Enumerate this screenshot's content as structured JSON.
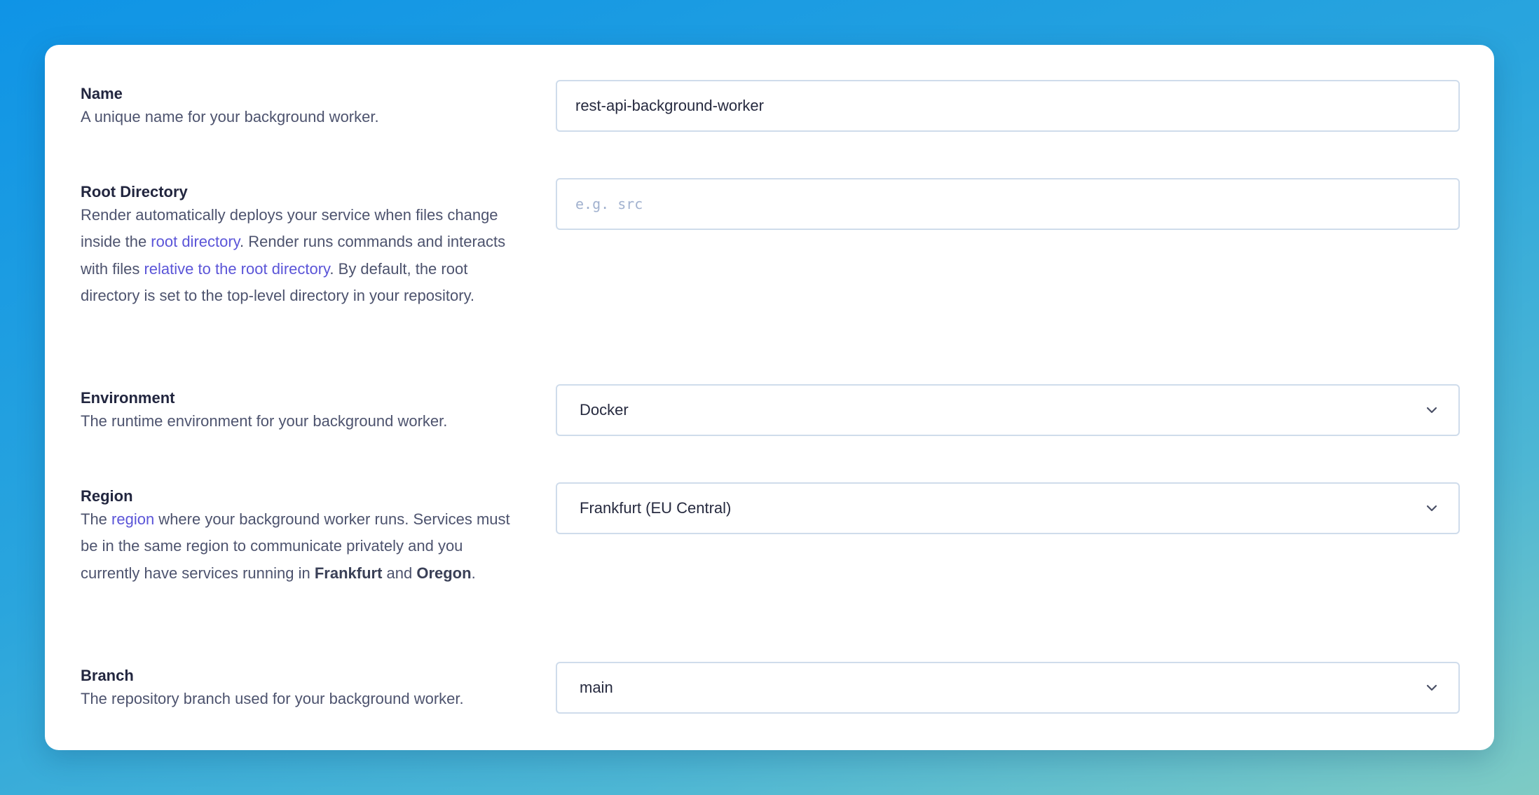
{
  "fields": {
    "name": {
      "title": "Name",
      "description": "A unique name for your background worker.",
      "value": "rest-api-background-worker"
    },
    "root_directory": {
      "title": "Root Directory",
      "desc_part1": "Render automatically deploys your service when files change inside the ",
      "link1": "root directory",
      "desc_part2": ". Render runs commands and interacts with files ",
      "link2": "relative to the root directory",
      "desc_part3": ". By default, the root directory is set to the top-level directory in your repository.",
      "placeholder": "e.g. src",
      "value": ""
    },
    "environment": {
      "title": "Environment",
      "description": "The runtime environment for your background worker.",
      "selected": "Docker"
    },
    "region": {
      "title": "Region",
      "desc_part1": "The ",
      "link": "region",
      "desc_part2": " where your background worker runs. Services must be in the same region to communicate privately and you currently have services running in ",
      "region_a": "Frankfurt",
      "desc_part3": " and ",
      "region_b": "Oregon",
      "desc_part4": ".",
      "selected": "Frankfurt (EU Central)"
    },
    "branch": {
      "title": "Branch",
      "description": "The repository branch used for your background worker.",
      "selected": "main"
    }
  },
  "icons": {
    "select_arrow": "chevron-down-icon"
  },
  "colors": {
    "link": "#5b55d8",
    "input_border": "#cfdceb",
    "title_text": "#22263f",
    "body_text": "#4d536e"
  }
}
